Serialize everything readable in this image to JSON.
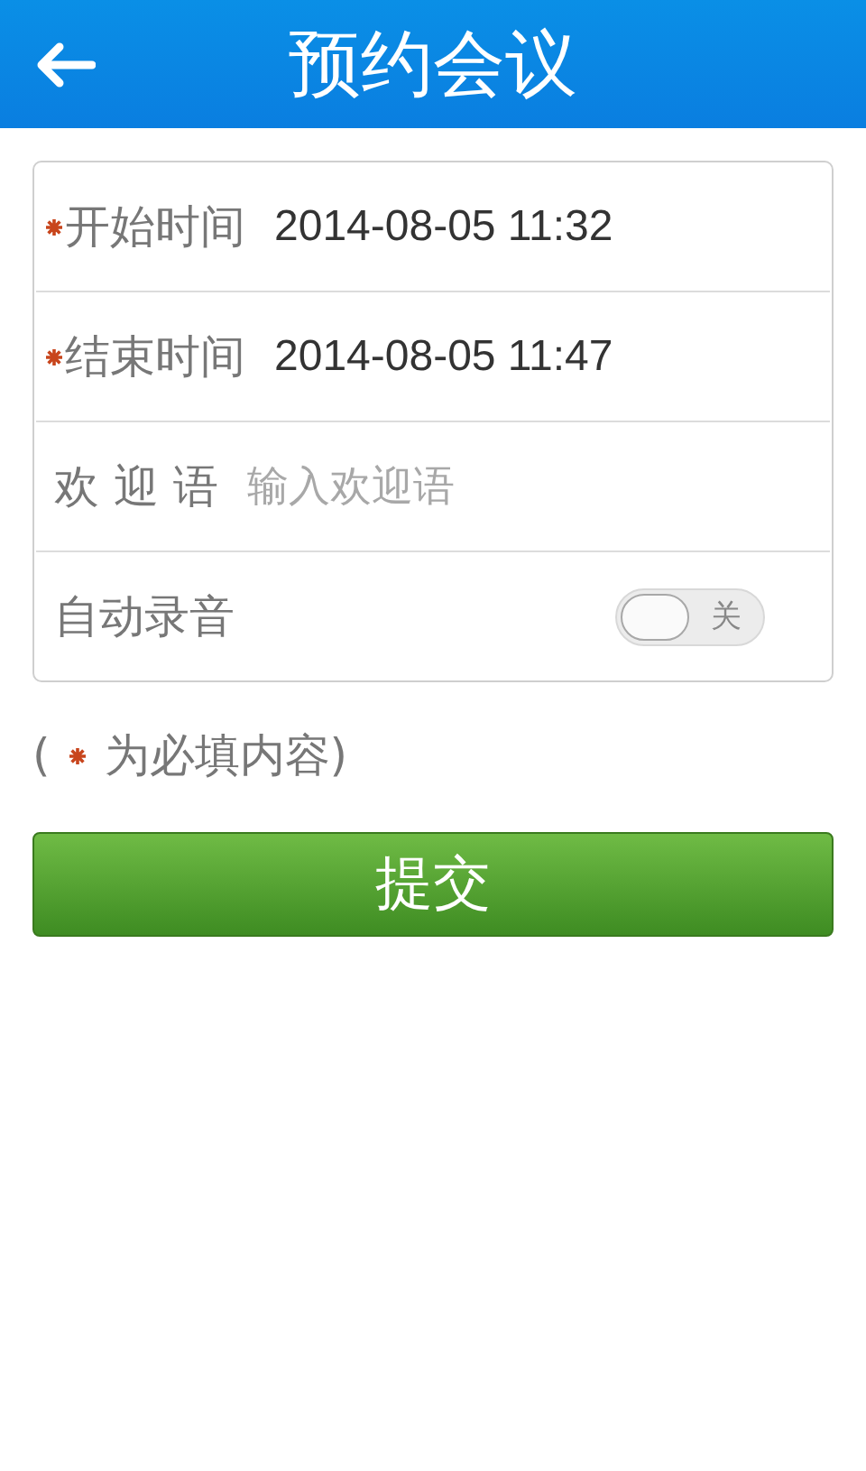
{
  "header": {
    "title": "预约会议"
  },
  "form": [
    {
      "kind": "value",
      "label": "开始时间",
      "required": true,
      "value": "2014-08-05 11:32"
    },
    {
      "kind": "value",
      "label": "结束时间",
      "required": true,
      "value": "2014-08-05 11:47"
    },
    {
      "kind": "input",
      "label": "欢 迎 语",
      "required": false,
      "placeholder": "输入欢迎语"
    },
    {
      "kind": "toggle",
      "label": "自动录音",
      "required": false,
      "on": false,
      "state_label": "关"
    }
  ],
  "note": {
    "before": "(",
    "after": "为必填内容)"
  },
  "submit": {
    "label": "提交"
  }
}
